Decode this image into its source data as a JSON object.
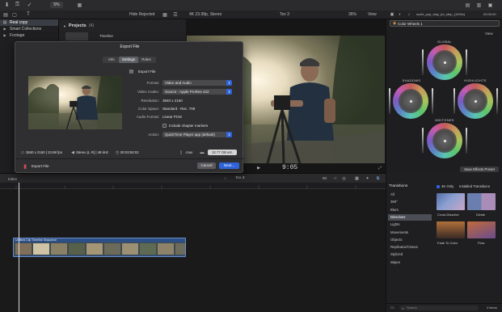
{
  "toolbar": {
    "zoom_label": "5%",
    "hide_rejected": "Hide Rejected",
    "resolution": "4K 23.98p, Stereo",
    "project_name": "Tex 3",
    "viewer_zoom": "36%",
    "view_label": "View",
    "clip_name": "sushi_pop_stay_(to_step_(1000x)",
    "clip_timecode": "00:00:00"
  },
  "library": {
    "items": [
      {
        "label": "Real copy",
        "selected": true
      },
      {
        "label": "Smart Collections",
        "selected": false
      },
      {
        "label": "Footage",
        "selected": false
      }
    ]
  },
  "browser": {
    "projects_header": "Projects",
    "projects_count": "(4)",
    "project_item": "Timeline"
  },
  "viewer": {
    "timecode": "9:05",
    "play_icon": "play-icon"
  },
  "inspector": {
    "title": "Color Wheels 1",
    "view_label": "View",
    "wheels": [
      {
        "label": "GLOBAL"
      },
      {
        "label": "SHADOWS"
      },
      {
        "label": "HIGHLIGHTS"
      },
      {
        "label": "MIDTONES"
      }
    ],
    "save_preset": "Save Effects Preset"
  },
  "timeline": {
    "index_label": "Index",
    "project": "Tex 3",
    "clip_label": "Untitled Clip Timeline Sequence"
  },
  "transitions": {
    "header": "Transitions",
    "filter_4k": "4K Only",
    "installed": "Installed Transitions",
    "categories": [
      "All",
      "360°",
      "Blurs",
      "Dissolves",
      "Lights",
      "Movements",
      "Objects",
      "Replicator/Clones",
      "Stylized",
      "Wipes"
    ],
    "selected_category": "Dissolves",
    "items": [
      {
        "label": "Cross Dissolve"
      },
      {
        "label": "Divide"
      },
      {
        "label": "Fade To Color"
      },
      {
        "label": "Flow"
      }
    ],
    "count_label": "4 items",
    "search_placeholder": "Search"
  },
  "dialog": {
    "title": "Export File",
    "tabs": [
      "Info",
      "Settings",
      "Roles"
    ],
    "active_tab": "Settings",
    "export_label": "Export File",
    "format_label": "Format:",
    "format_value": "Video and Audio",
    "codec_label": "Video Codec:",
    "codec_value": "Source - Apple ProRes 422",
    "resolution_label": "Resolution:",
    "resolution_value": "3840 x 2160",
    "colorspace_label": "Color Space:",
    "colorspace_value": "Standard - Rec. 709",
    "audioformat_label": "Audio Format:",
    "audioformat_value": "Linear PCM",
    "chapter_markers": "Include chapter markers",
    "action_label": "Action:",
    "action_value": "QuickTime Player app (default)",
    "spec_resolution": "3840 x 2160 | 23.98 fps",
    "spec_audio": "Stereo (L R) | 48 kHz",
    "spec_duration": "00:03:50:02",
    "file_ext": ".mov",
    "file_size": "22.77 GB est.",
    "footer_label": "Export File",
    "cancel": "Cancel",
    "next": "Next..."
  }
}
